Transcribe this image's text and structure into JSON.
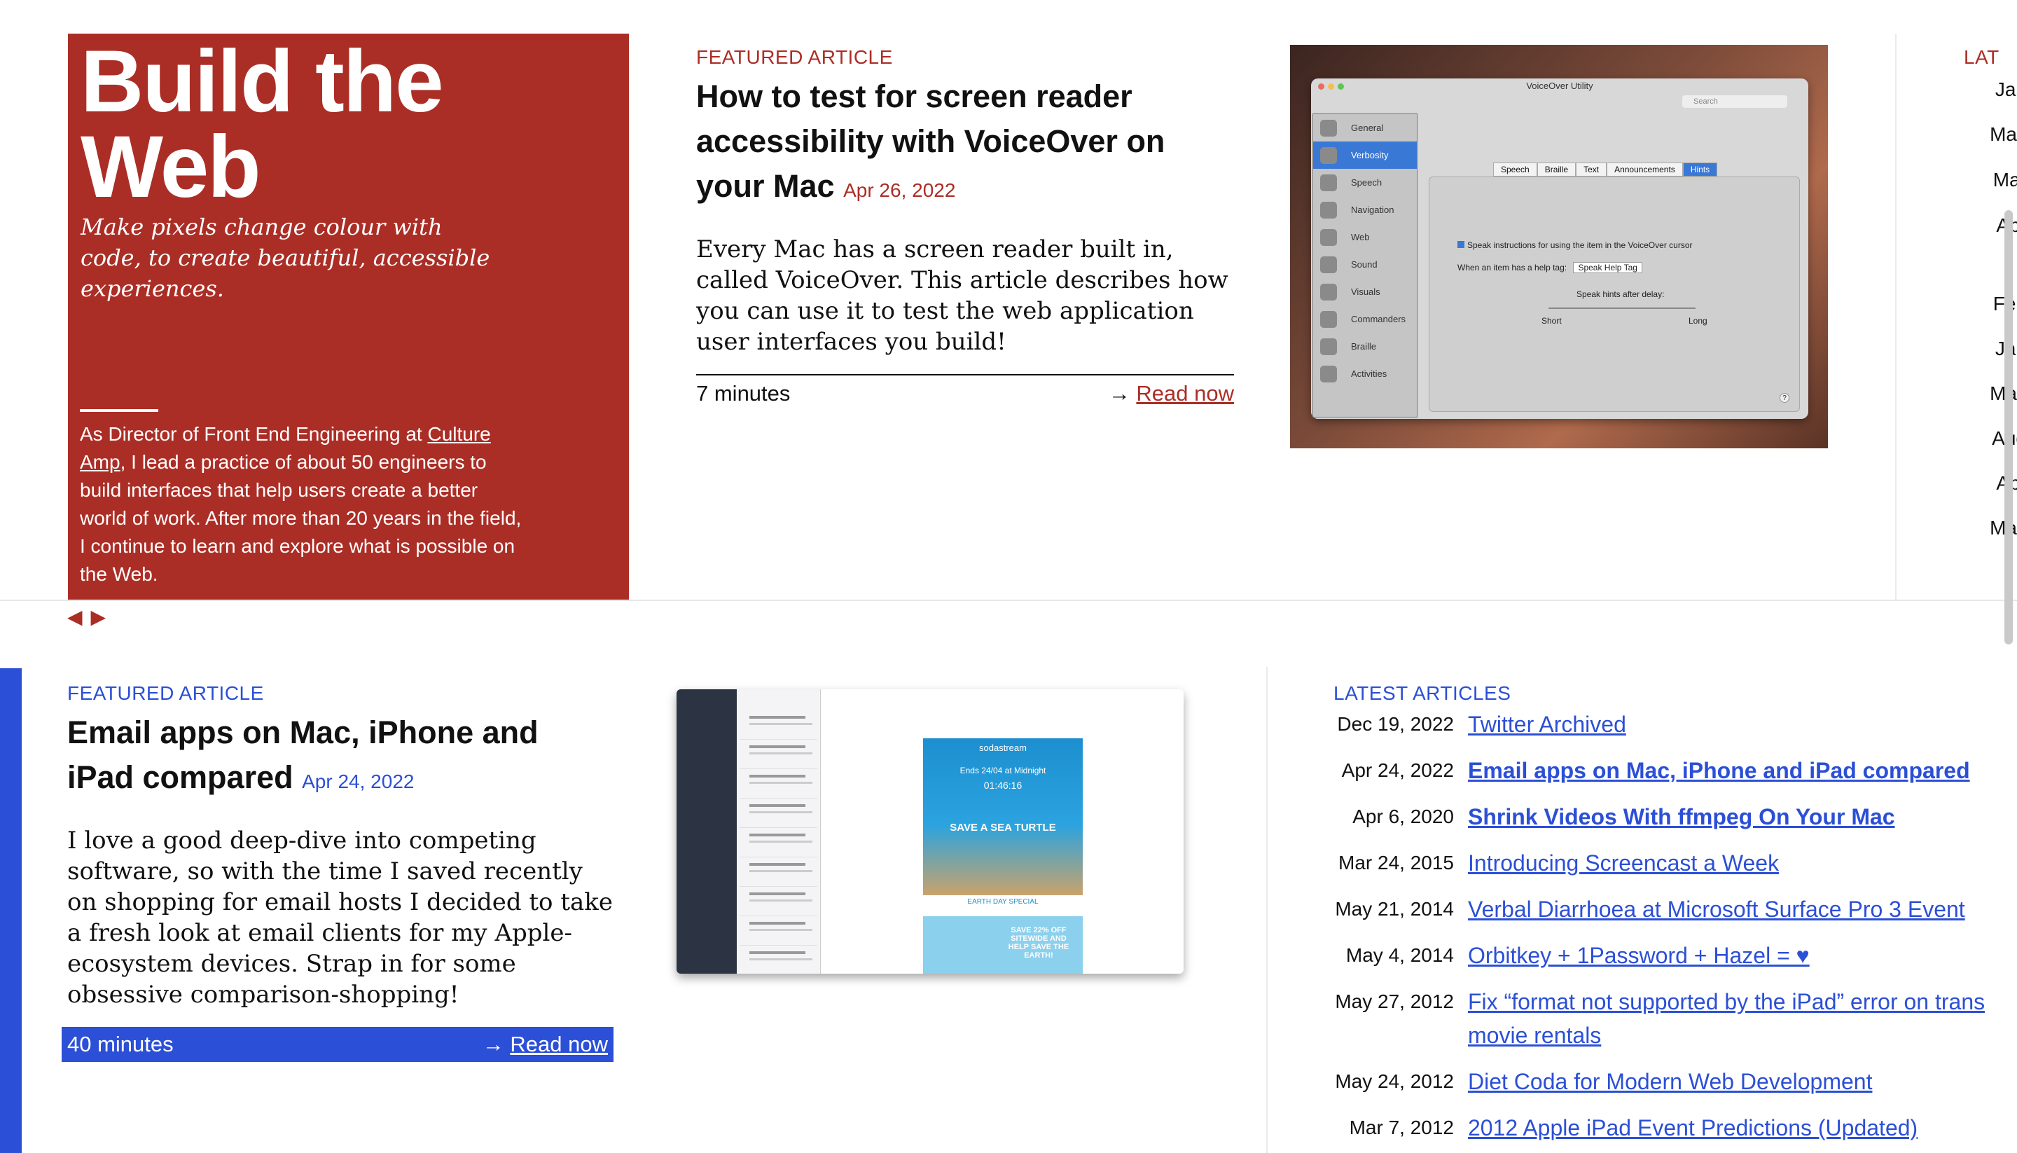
{
  "hero": {
    "title": "Build the Web",
    "tagline": "Make pixels change colour with code, to create beautiful, accessible experiences.",
    "bio_before": "As Director of Front End Engineering at ",
    "bio_link": "Culture Amp",
    "bio_after": ", I lead a practice of about 50 engineers to build interfaces that help users create a better world of work. After more than 20 years in the field, I continue to learn and explore what is possible on the Web.",
    "background": "#ab2e26"
  },
  "carousel": {
    "prev": "◀",
    "next": "▶"
  },
  "featured_top": {
    "kicker": "FEATURED ARTICLE",
    "title": "How to test for screen reader accessibility with VoiceOver on your Mac",
    "date": "Apr 26, 2022",
    "body": "Every Mac has a screen reader built in, called VoiceOver. This article describes how you can use it to test the web application user interfaces you build!",
    "read_time": "7 minutes",
    "arrow": "→",
    "read_label": "Read now",
    "accent": "#ab2e26"
  },
  "voiceover_shot": {
    "window_title": "VoiceOver Utility",
    "search": "Search",
    "sidebar": [
      "General",
      "Verbosity",
      "Speech",
      "Navigation",
      "Web",
      "Sound",
      "Visuals",
      "Commanders",
      "Braille",
      "Activities"
    ],
    "tabs": [
      "Speech",
      "Braille",
      "Text",
      "Announcements",
      "Hints"
    ],
    "checkbox_label": "Speak instructions for using the item in the VoiceOver cursor",
    "help_tag_label": "When an item has a help tag:",
    "help_tag_value": "Speak Help Tag",
    "delay_label": "Speak hints after delay:",
    "short": "Short",
    "long": "Long",
    "help": "?"
  },
  "latest_top": {
    "kicker": "LAT",
    "dates": [
      "Jan",
      "May",
      "Mar",
      "Apr",
      "Feb",
      "Jan",
      "May",
      "Aug",
      "Apr",
      "May"
    ]
  },
  "featured_bottom": {
    "kicker": "FEATURED ARTICLE",
    "title": "Email apps on Mac, iPhone and iPad compared",
    "date": "Apr 24, 2022",
    "body": "I love a good deep-dive into competing software, so with the time I saved recently on shopping for email hosts I decided to take a fresh look at email clients for my Apple-ecosystem devices. Strap in for some obsessive comparison-shopping!",
    "read_time": "40 minutes",
    "arrow": "→",
    "read_label": "Read now",
    "accent": "#2b4fd6"
  },
  "email_shot": {
    "brand": "sodastream",
    "promo_time": "Ends 24/04 at Midnight",
    "promo_clock": "01:46:16",
    "promo_headline": "SAVE A SEA TURTLE",
    "promo_sub": "EARTH DAY SPECIAL",
    "promo_offer": "SAVE 22% OFF SITEWIDE AND HELP SAVE THE EARTH!"
  },
  "latest": {
    "kicker": "LATEST ARTICLES",
    "items": [
      {
        "date": "Dec 19, 2022",
        "title": "Twitter Archived"
      },
      {
        "date": "Apr 24, 2022",
        "title": "Email apps on Mac, iPhone and iPad compared"
      },
      {
        "date": "Apr 6, 2020",
        "title": "Shrink Videos With ffmpeg On Your Mac"
      },
      {
        "date": "Mar 24, 2015",
        "title": "Introducing Screencast a Week"
      },
      {
        "date": "May 21, 2014",
        "title": "Verbal Diarrhoea at Microsoft Surface Pro 3 Event"
      },
      {
        "date": "May 4, 2014",
        "title": "Orbitkey + 1Password + Hazel = ♥"
      },
      {
        "date": "May 27, 2012",
        "title": "Fix “format not supported by the iPad” error on trans movie rentals"
      },
      {
        "date": "May 24, 2012",
        "title": "Diet Coda for Modern Web Development"
      },
      {
        "date": "Mar 7, 2012",
        "title": "2012 Apple iPad Event Predictions (Updated)"
      }
    ]
  }
}
